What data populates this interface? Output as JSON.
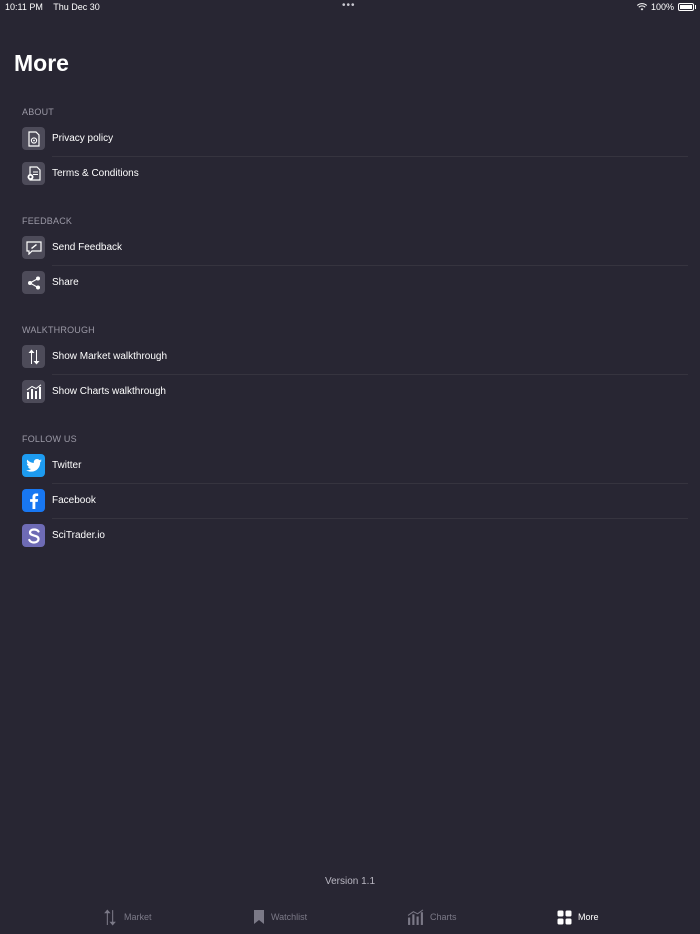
{
  "status": {
    "time": "10:11 PM",
    "date": "Thu Dec 30",
    "battery": "100%",
    "dots": "•••"
  },
  "page": {
    "title": "More"
  },
  "sections": [
    {
      "header": "ABOUT",
      "items": [
        {
          "label": "Privacy policy",
          "icon": "privacy-icon"
        },
        {
          "label": "Terms & Conditions",
          "icon": "terms-icon"
        }
      ]
    },
    {
      "header": "FEEDBACK",
      "items": [
        {
          "label": "Send Feedback",
          "icon": "feedback-icon"
        },
        {
          "label": "Share",
          "icon": "share-icon"
        }
      ]
    },
    {
      "header": "WALKTHROUGH",
      "items": [
        {
          "label": "Show Market walkthrough",
          "icon": "market-arrows-icon"
        },
        {
          "label": "Show Charts walkthrough",
          "icon": "charts-icon"
        }
      ]
    },
    {
      "header": "FOLLOW US",
      "items": [
        {
          "label": "Twitter",
          "icon": "twitter-icon"
        },
        {
          "label": "Facebook",
          "icon": "facebook-icon"
        },
        {
          "label": "SciTrader.io",
          "icon": "scitrader-icon"
        }
      ]
    }
  ],
  "version": "Version 1.1",
  "tabs": [
    {
      "label": "Market",
      "icon": "market-arrows-icon",
      "active": false
    },
    {
      "label": "Watchlist",
      "icon": "bookmark-icon",
      "active": false
    },
    {
      "label": "Charts",
      "icon": "charts-icon",
      "active": false
    },
    {
      "label": "More",
      "icon": "grid-icon",
      "active": true
    }
  ],
  "colors": {
    "background": "#282633",
    "icon_tile": "#4d4b59",
    "twitter": "#1d9bf0",
    "facebook": "#1877f2",
    "scitrader": "#6e6bb5",
    "tab_inactive": "#7b7987",
    "tab_active": "#ffffff"
  }
}
